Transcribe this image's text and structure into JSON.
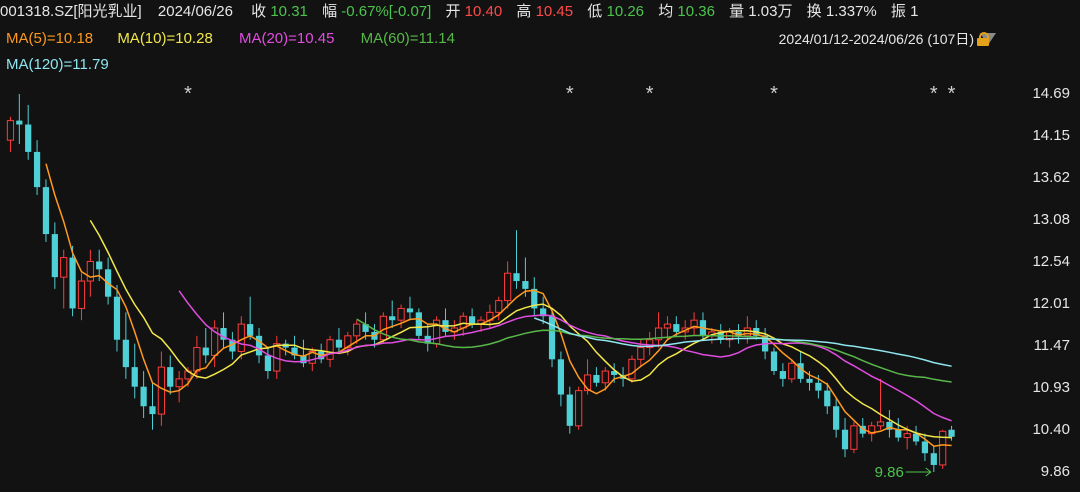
{
  "header": {
    "code": "001318.SZ[阳光乳业]",
    "date": "2024/06/26",
    "close_label": "收",
    "close": "10.31",
    "change_label": "幅",
    "change": "-0.67%[-0.07]",
    "open_label": "开",
    "open": "10.40",
    "high_label": "高",
    "high": "10.45",
    "low_label": "低",
    "low": "10.26",
    "avg_label": "均",
    "avg": "10.36",
    "vol_label": "量",
    "vol": "1.03万",
    "turnover_label": "换",
    "turnover": "1.337%",
    "amp_label": "振",
    "amp": "1"
  },
  "ma_legend": {
    "ma5": "MA(5)=10.18",
    "ma10": "MA(10)=10.28",
    "ma20": "MA(20)=10.45",
    "ma60": "MA(60)=11.14",
    "ma120": "MA(120)=11.79"
  },
  "range": {
    "text": "2024/01/12-2024/06/26 (107日)"
  },
  "colors": {
    "up": "#ff3b3b",
    "down": "#4fd0d6",
    "ma5": "#ff9a1f",
    "ma10": "#f2e84a",
    "ma20": "#e04de0",
    "ma60": "#59b84a",
    "ma120": "#8fe6ee"
  },
  "chart_data": {
    "type": "candlestick",
    "date_range": [
      "2024/01/12",
      "2024/06/26"
    ],
    "bars": 107,
    "y_ticks": [
      "14.69",
      "14.15",
      "13.62",
      "13.08",
      "12.54",
      "12.01",
      "11.47",
      "10.93",
      "10.40",
      "9.86"
    ],
    "ylim": [
      9.86,
      14.69
    ],
    "low_annotation": "9.86",
    "star_markers": [
      "*",
      "*",
      "*",
      "*",
      "*",
      "*"
    ],
    "candles": [
      [
        14.1,
        14.4,
        13.95,
        14.35
      ],
      [
        14.35,
        14.69,
        14.05,
        14.3
      ],
      [
        14.3,
        14.55,
        13.85,
        13.95
      ],
      [
        13.95,
        14.1,
        13.4,
        13.5
      ],
      [
        13.5,
        13.6,
        12.8,
        12.9
      ],
      [
        12.9,
        13.05,
        12.2,
        12.35
      ],
      [
        12.35,
        12.7,
        11.95,
        12.6
      ],
      [
        12.6,
        12.75,
        11.85,
        11.95
      ],
      [
        11.95,
        12.4,
        11.8,
        12.3
      ],
      [
        12.3,
        12.7,
        12.1,
        12.55
      ],
      [
        12.55,
        12.7,
        12.3,
        12.45
      ],
      [
        12.45,
        12.6,
        12.0,
        12.1
      ],
      [
        12.1,
        12.25,
        11.4,
        11.55
      ],
      [
        11.55,
        11.9,
        11.05,
        11.2
      ],
      [
        11.2,
        11.5,
        10.8,
        10.95
      ],
      [
        10.95,
        11.15,
        10.55,
        10.7
      ],
      [
        10.7,
        11.0,
        10.4,
        10.6
      ],
      [
        10.6,
        11.4,
        10.45,
        11.2
      ],
      [
        11.2,
        11.35,
        10.85,
        10.95
      ],
      [
        10.95,
        11.15,
        10.75,
        11.05
      ],
      [
        11.05,
        11.2,
        10.95,
        11.15
      ],
      [
        11.15,
        11.6,
        11.05,
        11.45
      ],
      [
        11.45,
        11.7,
        11.25,
        11.35
      ],
      [
        11.35,
        11.8,
        11.2,
        11.7
      ],
      [
        11.7,
        11.9,
        11.45,
        11.55
      ],
      [
        11.55,
        11.65,
        11.3,
        11.4
      ],
      [
        11.4,
        11.85,
        11.3,
        11.75
      ],
      [
        11.75,
        12.1,
        11.55,
        11.6
      ],
      [
        11.6,
        11.7,
        11.25,
        11.35
      ],
      [
        11.35,
        11.45,
        11.05,
        11.15
      ],
      [
        11.15,
        11.6,
        11.05,
        11.5
      ],
      [
        11.5,
        11.55,
        11.35,
        11.45
      ],
      [
        11.45,
        11.6,
        11.3,
        11.35
      ],
      [
        11.35,
        11.55,
        11.2,
        11.25
      ],
      [
        11.25,
        11.45,
        11.15,
        11.4
      ],
      [
        11.4,
        11.5,
        11.25,
        11.3
      ],
      [
        11.3,
        11.6,
        11.2,
        11.55
      ],
      [
        11.55,
        11.7,
        11.4,
        11.45
      ],
      [
        11.45,
        11.65,
        11.35,
        11.6
      ],
      [
        11.6,
        11.8,
        11.5,
        11.75
      ],
      [
        11.75,
        11.9,
        11.55,
        11.65
      ],
      [
        11.65,
        11.75,
        11.45,
        11.55
      ],
      [
        11.55,
        11.9,
        11.5,
        11.85
      ],
      [
        11.85,
        12.05,
        11.7,
        11.8
      ],
      [
        11.8,
        12.0,
        11.7,
        11.95
      ],
      [
        11.95,
        12.1,
        11.8,
        11.9
      ],
      [
        11.9,
        11.95,
        11.55,
        11.6
      ],
      [
        11.6,
        11.75,
        11.4,
        11.5
      ],
      [
        11.5,
        11.85,
        11.45,
        11.8
      ],
      [
        11.8,
        11.95,
        11.6,
        11.65
      ],
      [
        11.65,
        11.8,
        11.55,
        11.7
      ],
      [
        11.7,
        11.9,
        11.6,
        11.85
      ],
      [
        11.85,
        11.95,
        11.7,
        11.75
      ],
      [
        11.75,
        11.85,
        11.65,
        11.8
      ],
      [
        11.8,
        12.0,
        11.7,
        11.9
      ],
      [
        11.9,
        12.1,
        11.8,
        12.05
      ],
      [
        12.05,
        12.55,
        11.95,
        12.4
      ],
      [
        12.4,
        12.95,
        12.2,
        12.3
      ],
      [
        12.3,
        12.6,
        12.1,
        12.2
      ],
      [
        12.2,
        12.35,
        11.85,
        11.95
      ],
      [
        11.95,
        12.1,
        11.75,
        11.85
      ],
      [
        11.85,
        11.95,
        11.2,
        11.3
      ],
      [
        11.3,
        11.4,
        10.7,
        10.85
      ],
      [
        10.85,
        10.95,
        10.35,
        10.45
      ],
      [
        10.45,
        10.95,
        10.4,
        10.9
      ],
      [
        10.9,
        11.3,
        10.85,
        11.1
      ],
      [
        11.1,
        11.2,
        10.95,
        11.0
      ],
      [
        11.0,
        11.2,
        10.9,
        11.15
      ],
      [
        11.15,
        11.25,
        11.0,
        11.1
      ],
      [
        11.1,
        11.2,
        10.95,
        11.05
      ],
      [
        11.05,
        11.35,
        11.0,
        11.3
      ],
      [
        11.3,
        11.55,
        11.2,
        11.45
      ],
      [
        11.45,
        11.65,
        11.35,
        11.55
      ],
      [
        11.55,
        11.9,
        11.45,
        11.7
      ],
      [
        11.7,
        11.85,
        11.55,
        11.75
      ],
      [
        11.75,
        11.85,
        11.6,
        11.65
      ],
      [
        11.65,
        11.8,
        11.55,
        11.7
      ],
      [
        11.7,
        11.9,
        11.6,
        11.8
      ],
      [
        11.8,
        11.9,
        11.55,
        11.6
      ],
      [
        11.6,
        11.7,
        11.5,
        11.65
      ],
      [
        11.65,
        11.75,
        11.5,
        11.55
      ],
      [
        11.55,
        11.7,
        11.45,
        11.65
      ],
      [
        11.65,
        11.75,
        11.5,
        11.6
      ],
      [
        11.6,
        11.85,
        11.5,
        11.7
      ],
      [
        11.7,
        11.8,
        11.55,
        11.6
      ],
      [
        11.6,
        11.7,
        11.3,
        11.4
      ],
      [
        11.4,
        11.45,
        11.1,
        11.15
      ],
      [
        11.15,
        11.25,
        10.95,
        11.05
      ],
      [
        11.05,
        11.3,
        11.0,
        11.25
      ],
      [
        11.25,
        11.4,
        11.0,
        11.05
      ],
      [
        11.05,
        11.15,
        10.9,
        11.0
      ],
      [
        11.0,
        11.1,
        10.8,
        10.9
      ],
      [
        10.9,
        11.0,
        10.6,
        10.7
      ],
      [
        10.7,
        10.8,
        10.3,
        10.4
      ],
      [
        10.4,
        10.55,
        10.05,
        10.15
      ],
      [
        10.15,
        10.5,
        10.1,
        10.45
      ],
      [
        10.45,
        10.55,
        10.3,
        10.35
      ],
      [
        10.35,
        10.5,
        10.25,
        10.45
      ],
      [
        10.45,
        11.05,
        10.4,
        10.5
      ],
      [
        10.5,
        10.65,
        10.3,
        10.4
      ],
      [
        10.4,
        10.55,
        10.25,
        10.3
      ],
      [
        10.3,
        10.45,
        10.15,
        10.35
      ],
      [
        10.35,
        10.45,
        10.2,
        10.25
      ],
      [
        10.25,
        10.35,
        10.0,
        10.1
      ],
      [
        10.1,
        10.2,
        9.86,
        9.95
      ],
      [
        9.95,
        10.4,
        9.9,
        10.38
      ],
      [
        10.4,
        10.45,
        10.26,
        10.31
      ]
    ]
  }
}
